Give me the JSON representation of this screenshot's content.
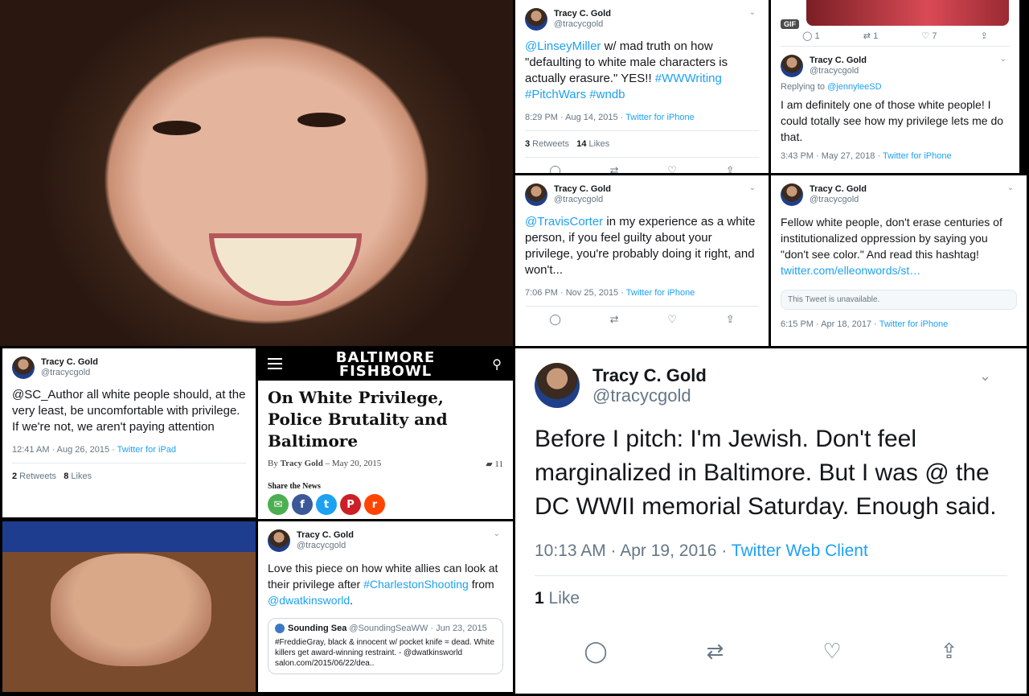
{
  "tweets": {
    "t1": {
      "name": "Tracy C. Gold",
      "handle": "@tracycgold",
      "mention": "@LinseyMiller",
      "text": " w/ mad truth on how \"defaulting to white male characters is actually erasure.\" YES!! ",
      "tags": "#WWWriting #PitchWars #wndb",
      "time": "8:29 PM · Aug 14, 2015 · ",
      "client": "Twitter for iPhone",
      "retweets_count": "3",
      "retweets_label": " Retweets",
      "likes_count": "14",
      "likes_label": " Likes"
    },
    "t2": {
      "gif_label": "GIF",
      "reply_count": "1",
      "retweet_count": "1",
      "like_count": "7",
      "name": "Tracy C. Gold",
      "handle": "@tracycgold",
      "replying_prefix": "Replying to ",
      "replying_to": "@jennyleeSD",
      "text": "I am definitely one of those white people! I could totally see how my privilege lets me do that.",
      "time": "3:43 PM · May 27, 2018 · ",
      "client": "Twitter for iPhone"
    },
    "t3": {
      "name": "Tracy C. Gold",
      "handle": "@tracycgold",
      "mention": "@TravisCorter",
      "text": " in my experience as a white person, if you feel guilty about your privilege, you're probably doing it right, and won't...",
      "time": "7:06 PM · Nov 25, 2015 · ",
      "client": "Twitter for iPhone"
    },
    "t4": {
      "name": "Tracy C. Gold",
      "handle": "@tracycgold",
      "text": "Fellow white people, don't erase centuries of institutionalized oppression by saying you \"don't see color.\" And read this hashtag! ",
      "link": "twitter.com/elleonwords/st…",
      "unavailable": "This Tweet is unavailable.",
      "time": "6:15 PM · Apr 18, 2017 · ",
      "client": "Twitter for iPhone"
    },
    "t5": {
      "name": "Tracy C. Gold",
      "handle": "@tracycgold",
      "text": "@SC_Author all white people should, at the very least, be uncomfortable with privilege. If we're not, we aren't paying attention",
      "time": "12:41 AM · Aug 26, 2015 · ",
      "client": "Twitter for iPad",
      "retweets_count": "2",
      "retweets_label": " Retweets",
      "likes_count": "8",
      "likes_label": " Likes"
    },
    "t6": {
      "name": "Tracy C. Gold",
      "handle": "@tracycgold",
      "text": "Love this piece on how white allies can look at their privilege after ",
      "tag": "#CharlestonShooting",
      "from": " from ",
      "mention": "@dwatkinsworld",
      "end": ".",
      "quote_name": "Sounding Sea",
      "quote_meta": " @SoundingSeaWW · Jun 23, 2015",
      "quote_text": "#FreddieGray, black & innocent w/ pocket knife = dead. White killers get award-winning restraint. - @dwatkinsworld salon.com/2015/06/22/dea.."
    },
    "big": {
      "name": "Tracy C. Gold",
      "handle": "@tracycgold",
      "text": "Before I pitch: I'm Jewish. Don't feel marginalized in Baltimore. But I was @ the DC WWII memorial Saturday. Enough said.",
      "time": "10:13 AM · Apr 19, 2016 · ",
      "client": "Twitter Web Client",
      "likes_count": "1",
      "likes_label": " Like"
    }
  },
  "article": {
    "logo_line1": "BALTIMORE",
    "logo_line2": "FISHBOWL",
    "title": "On White Privilege, Police Brutality and Baltimore",
    "by": "By ",
    "author": "Tracy Gold",
    "date": " – May 20, 2015",
    "comments": "11",
    "share_label": "Share the News"
  },
  "icons": {
    "reply": "reply-icon",
    "retweet": "retweet-icon",
    "like": "heart-icon",
    "share": "share-icon",
    "chevron": "chevron-down-icon"
  },
  "colors": {
    "link": "#1da1f2",
    "muted": "#657786"
  }
}
